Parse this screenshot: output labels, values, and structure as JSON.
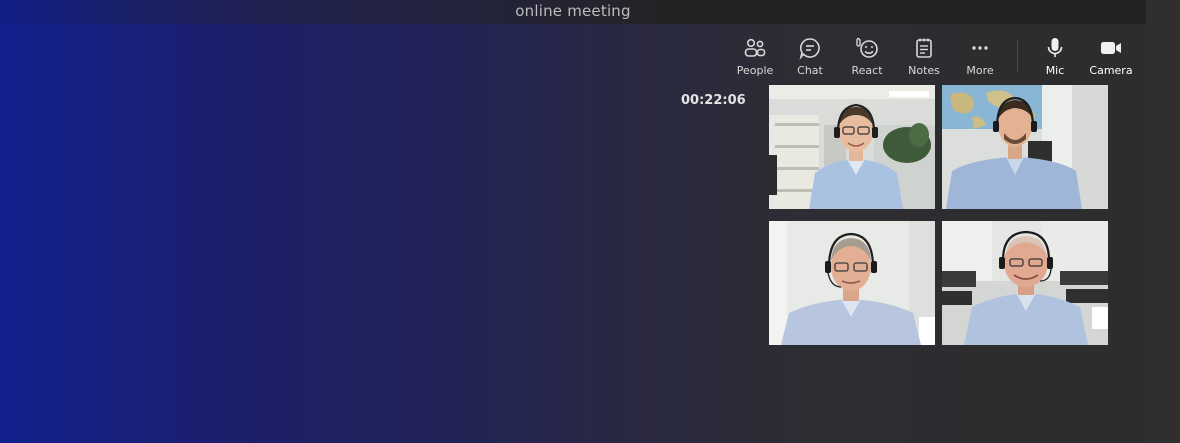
{
  "window": {
    "title": "online meeting"
  },
  "toolbar": {
    "items": [
      {
        "label": "People",
        "icon": "people-icon"
      },
      {
        "label": "Chat",
        "icon": "chat-icon"
      },
      {
        "label": "React",
        "icon": "react-icon"
      },
      {
        "label": "Notes",
        "icon": "notes-icon"
      },
      {
        "label": "More",
        "icon": "more-icon"
      },
      {
        "label": "Mic",
        "icon": "mic-icon"
      },
      {
        "label": "Camera",
        "icon": "camera-icon"
      }
    ]
  },
  "meeting": {
    "elapsed": "00:22:06"
  },
  "participants": [
    {
      "tile": "video-tile-1"
    },
    {
      "tile": "video-tile-2"
    },
    {
      "tile": "video-tile-3"
    },
    {
      "tile": "video-tile-4"
    }
  ],
  "colors": {
    "accent_gradient_start": "#13208e",
    "panel": "#2d2d2d"
  }
}
